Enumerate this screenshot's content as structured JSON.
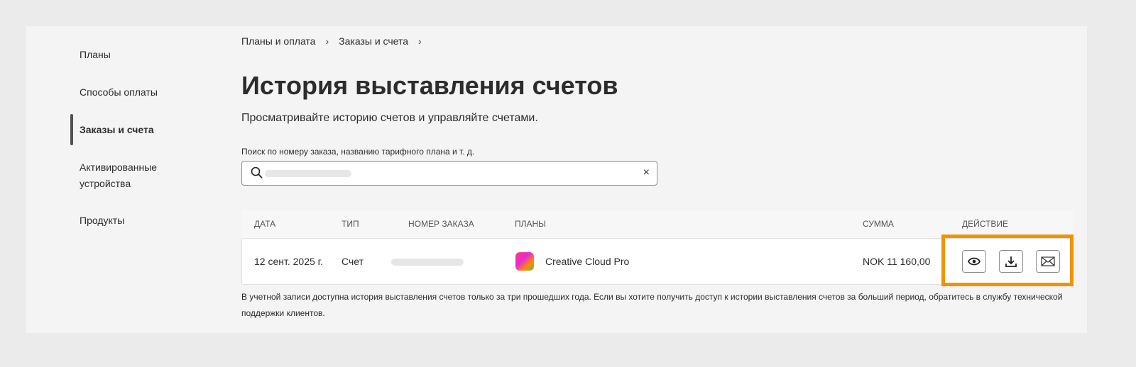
{
  "sidebar": {
    "items": [
      {
        "label": "Планы"
      },
      {
        "label": "Способы оплаты"
      },
      {
        "label": "Заказы и счета",
        "active": true
      },
      {
        "label": "Активированные устройства"
      },
      {
        "label": "Продукты"
      }
    ]
  },
  "breadcrumb": [
    "Планы и оплата",
    "Заказы и счета"
  ],
  "page": {
    "title": "История выставления счетов",
    "subtitle": "Просматривайте историю счетов и управляйте счетами."
  },
  "search": {
    "label": "Поиск по номеру заказа, названию тарифного плана и т. д.",
    "icon": "search-icon",
    "clear_icon": "×"
  },
  "table": {
    "headers": [
      "ДАТА",
      "ТИП",
      "НОМЕР ЗАКАЗА",
      "ПЛАНЫ",
      "СУММА",
      "ДЕЙСТВИЕ"
    ],
    "rows": [
      {
        "date": "12 сент. 2025 г.",
        "type": "Счет",
        "plan": "Creative Cloud Pro",
        "amount": "NOK 11 160,00"
      }
    ]
  },
  "note": "В учетной записи доступна история выставления счетов только за три прошедших года. Если вы хотите получить доступ к истории выставления счетов за больший период, обратитесь в службу технической поддержки клиентов.",
  "colors": {
    "highlight": "#f39200"
  }
}
